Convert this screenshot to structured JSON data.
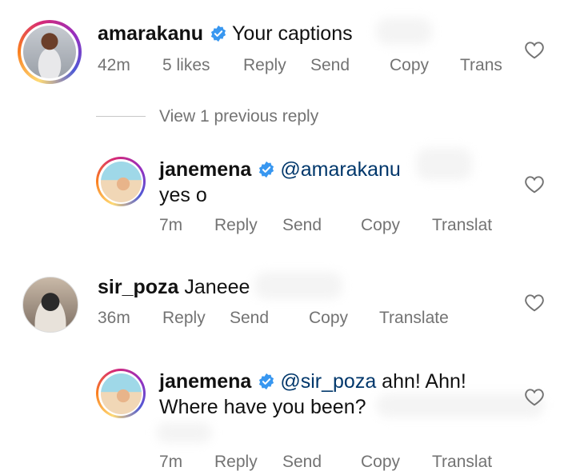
{
  "comments": [
    {
      "username": "amarakanu",
      "text": "Your captions",
      "time": "42m",
      "likes": "5 likes",
      "actions": [
        "Reply",
        "Send",
        "Copy",
        "Trans"
      ]
    },
    {
      "view_previous": "View 1 previous reply"
    },
    {
      "username": "janemena",
      "mention": "@amarakanu",
      "text": "yes o",
      "time": "7m",
      "actions": [
        "Reply",
        "Send",
        "Copy",
        "Translat"
      ]
    },
    {
      "username": "sir_poza",
      "text": "Janeee",
      "time": "36m",
      "actions": [
        "Reply",
        "Send",
        "Copy",
        "Translate"
      ]
    },
    {
      "username": "janemena",
      "mention": "@sir_poza",
      "text_line1": "ahn! Ahn!",
      "text_line2": "Where have you been?",
      "time": "7m",
      "actions": [
        "Reply",
        "Send",
        "Copy",
        "Translat"
      ]
    }
  ],
  "colors": {
    "verified": "#3897f0",
    "mention": "#00376b",
    "meta": "#737373"
  },
  "icons": [
    "verified-badge-icon",
    "heart-icon"
  ]
}
